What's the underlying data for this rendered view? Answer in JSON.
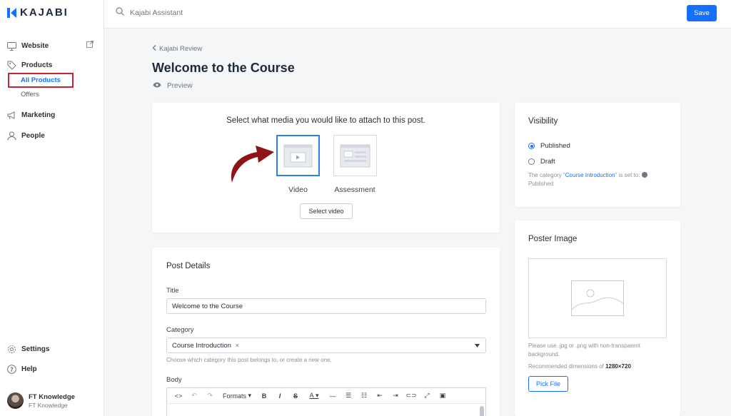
{
  "brand": {
    "name": "KAJABI",
    "accent": "#1670ff"
  },
  "sidebar": {
    "items": [
      {
        "label": "Website",
        "icon": "monitor-icon"
      },
      {
        "label": "Products",
        "icon": "tag-icon"
      },
      {
        "label": "Marketing",
        "icon": "megaphone-icon"
      },
      {
        "label": "People",
        "icon": "person-icon"
      }
    ],
    "sub_items": {
      "all_products": "All Products",
      "offers": "Offers"
    },
    "bottom": [
      {
        "label": "Settings",
        "icon": "gear-icon"
      },
      {
        "label": "Help",
        "icon": "help-icon"
      }
    ],
    "user": {
      "name": "FT Knowledge",
      "sub": "FT Knowledge"
    }
  },
  "topbar": {
    "search_placeholder": "Kajabi Assistant",
    "save_label": "Save"
  },
  "header": {
    "breadcrumb": "Kajabi Review",
    "title": "Welcome to the Course",
    "preview": "Preview"
  },
  "media": {
    "prompt": "Select what media you would like to attach to this post.",
    "options": [
      "Video",
      "Assessment"
    ],
    "selected": "Video",
    "select_button": "Select video"
  },
  "details": {
    "title": "Post Details",
    "title_label": "Title",
    "title_value": "Welcome to the Course",
    "category_label": "Category",
    "category_value": "Course Introduction",
    "category_remove": "×",
    "category_help": "Choose which category this post belongs to, or create a new one.",
    "body_label": "Body",
    "toolbar_formats": "Formats"
  },
  "visibility": {
    "title": "Visibility",
    "options": [
      "Published",
      "Draft"
    ],
    "selected": "Published",
    "note_prefix": "The category \"",
    "note_link": "Course Introduction",
    "note_suffix": "\" is set to:",
    "note_state": "Published"
  },
  "poster": {
    "title": "Poster Image",
    "help": "Please use .jpg or .png with non-transparent background.",
    "dims_prefix": "Recommended dimensions of",
    "dims_value": "1280×720",
    "pick_label": "Pick File"
  }
}
